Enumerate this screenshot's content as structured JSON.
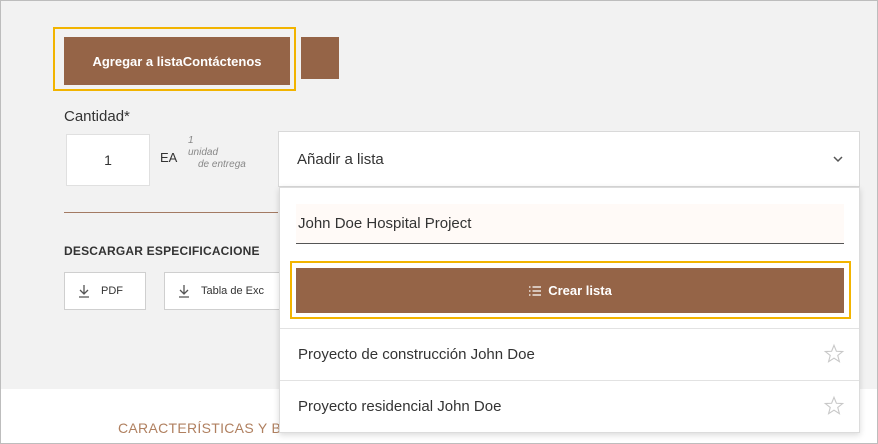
{
  "actions": {
    "add_to_list_label": "Agregar a listaContáctenos"
  },
  "quantity": {
    "label": "Cantidad*",
    "value": "1",
    "unit": "EA",
    "delivery_count": "1",
    "delivery_line1": "unidad",
    "delivery_line2": "de entrega"
  },
  "list_select": {
    "selected": "Añadir a lista",
    "icon": "chevron-down-icon"
  },
  "downloads": {
    "heading": "DESCARGAR ESPECIFICACIONE",
    "pdf_label": "PDF",
    "table_label": "Tabla de Exc"
  },
  "dropdown": {
    "new_list_value": "John Doe Hospital Project",
    "create_label": "Crear lista",
    "items": [
      {
        "label": "Proyecto de construcción John Doe"
      },
      {
        "label": "Proyecto residencial John Doe"
      }
    ]
  },
  "tabs": {
    "features_label": "CARACTERÍSTICAS Y B"
  },
  "colors": {
    "brand_brown": "#956447",
    "highlight": "#f2b400"
  }
}
